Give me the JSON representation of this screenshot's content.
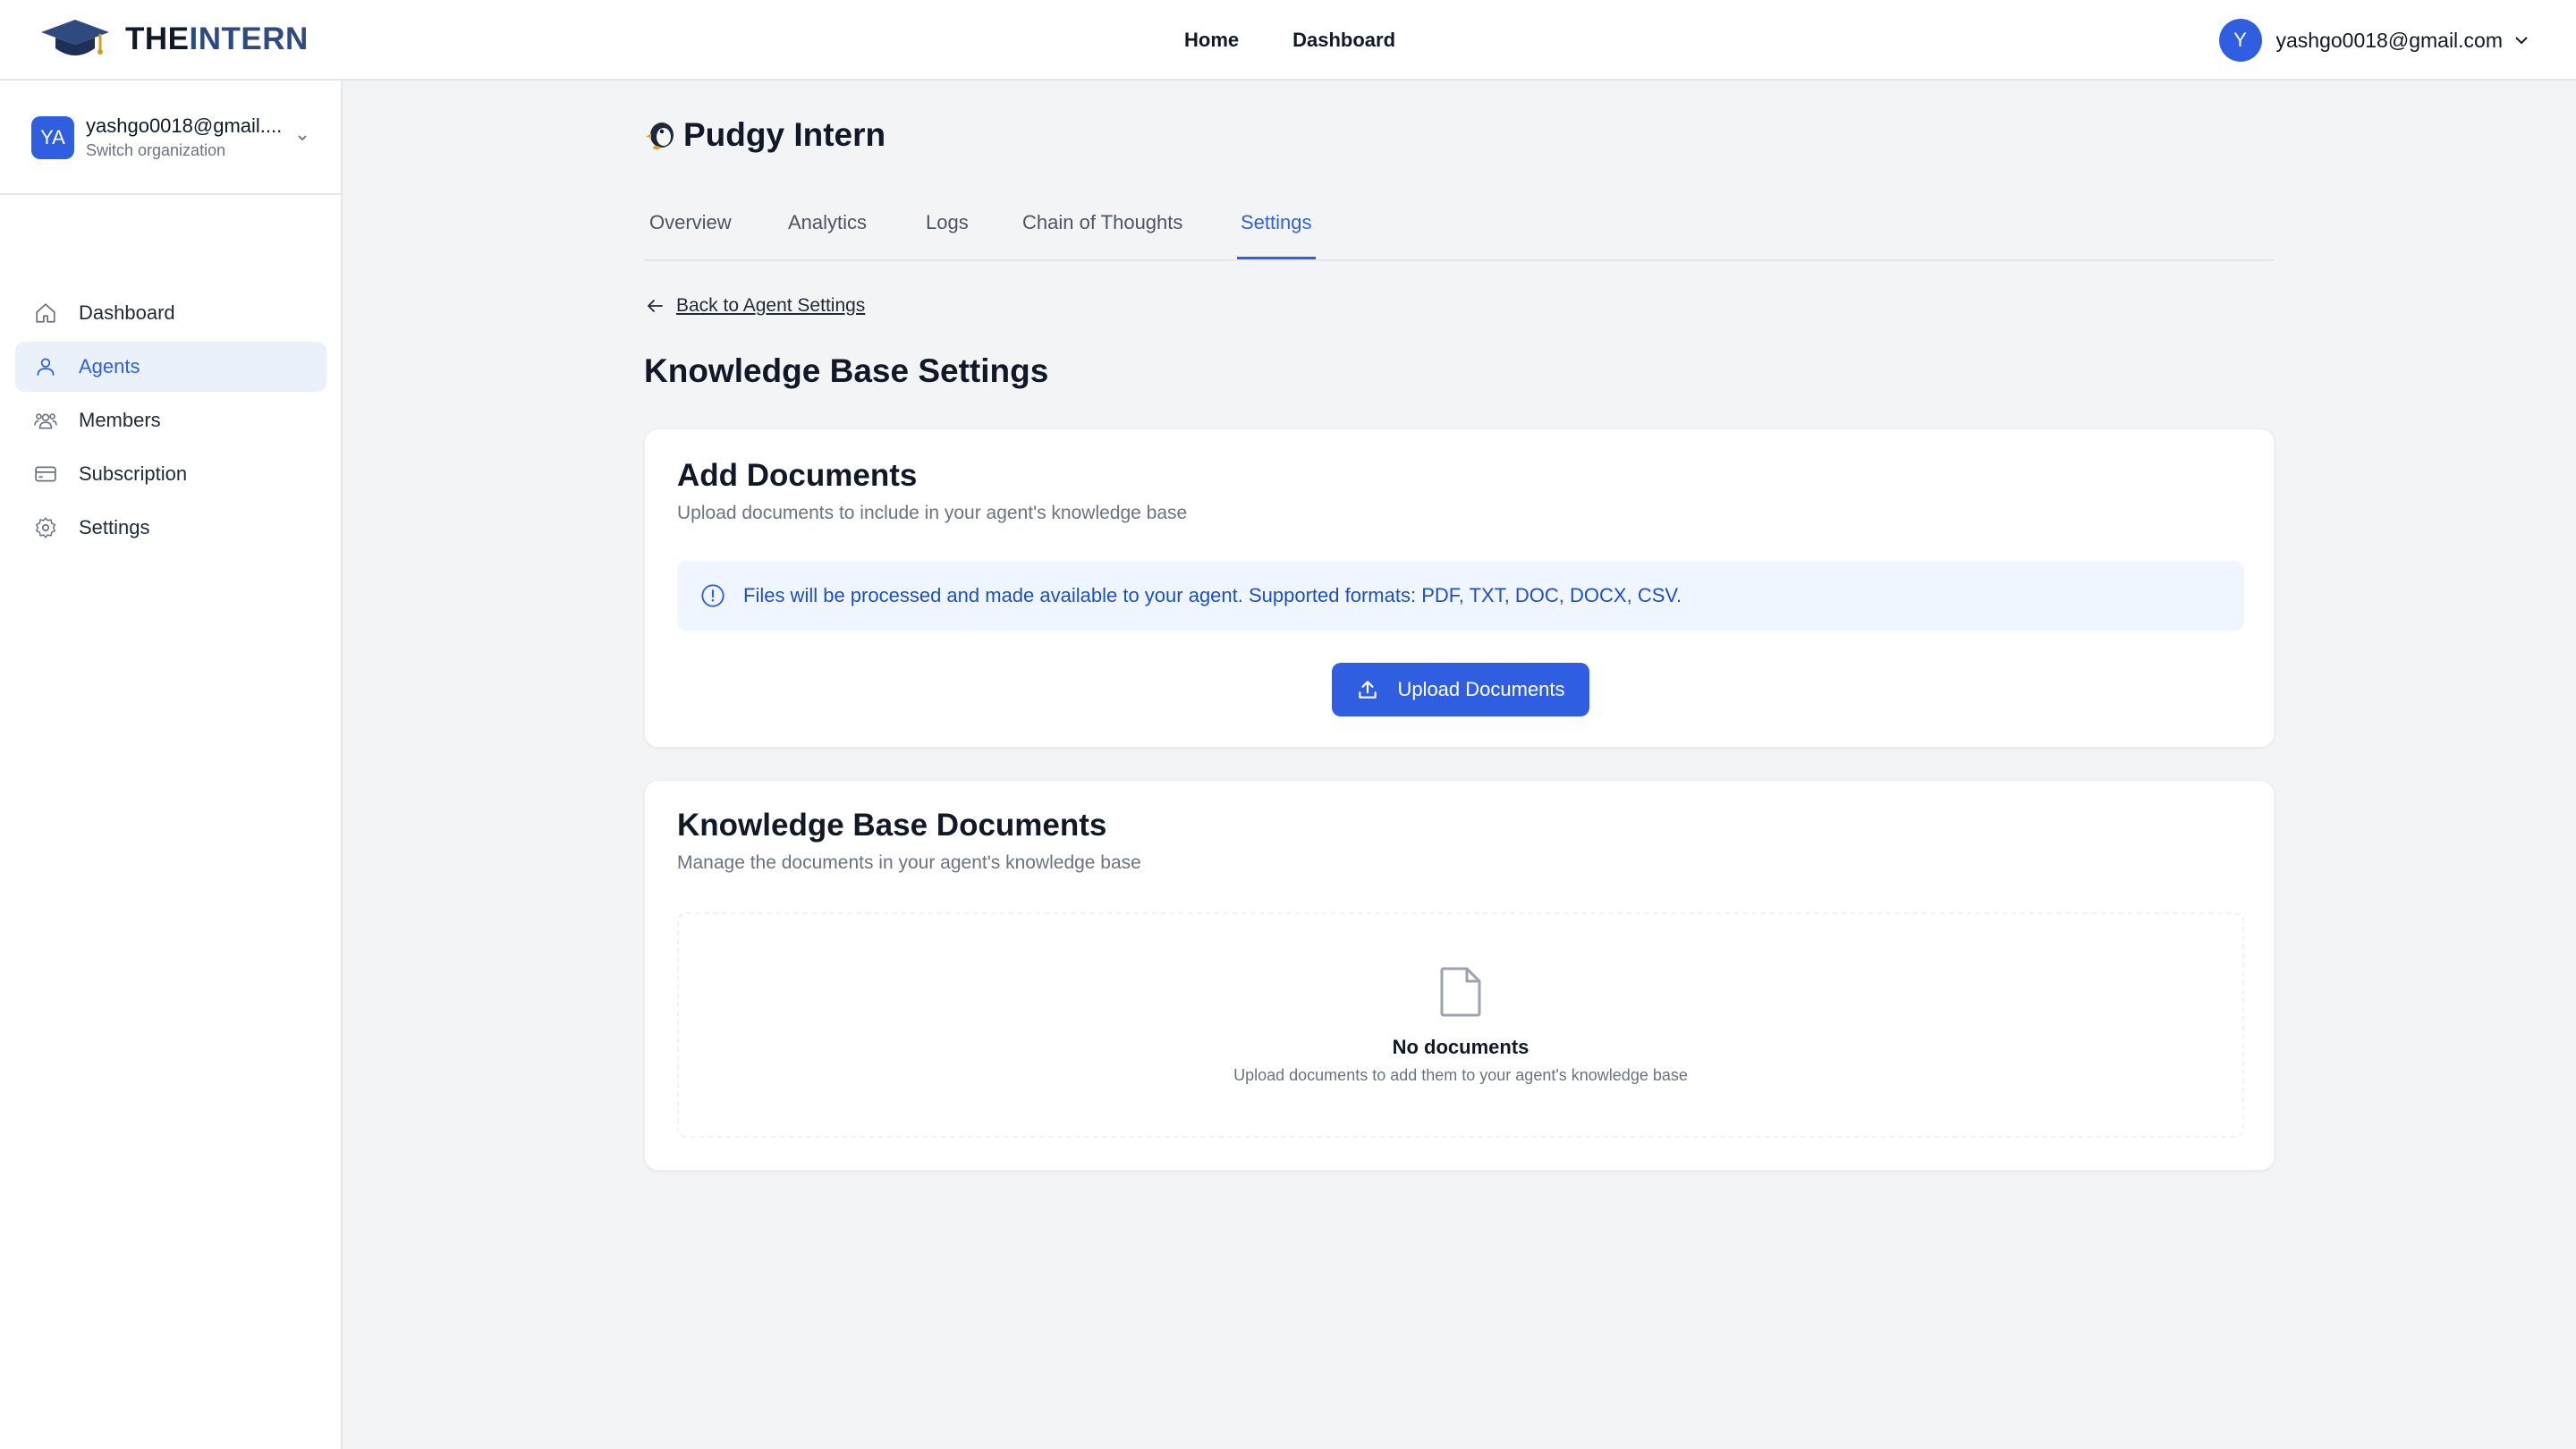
{
  "brand": {
    "logo_the": "THE",
    "logo_intern": "INTERN",
    "logo_icon": "graduation-cap-icon"
  },
  "topnav": {
    "home": "Home",
    "dashboard": "Dashboard"
  },
  "user": {
    "avatar_initial": "Y",
    "email": "yashgo0018@gmail.com"
  },
  "org": {
    "avatar": "YA",
    "name": "yashgo0018@gmail....",
    "subtitle": "Switch organization"
  },
  "sidebar": {
    "items": [
      {
        "label": "Dashboard",
        "icon": "home-icon",
        "active": false
      },
      {
        "label": "Agents",
        "icon": "user-icon",
        "active": true
      },
      {
        "label": "Members",
        "icon": "users-icon",
        "active": false
      },
      {
        "label": "Subscription",
        "icon": "credit-card-icon",
        "active": false
      },
      {
        "label": "Settings",
        "icon": "gear-icon",
        "active": false
      }
    ]
  },
  "agent": {
    "name": "Pudgy Intern",
    "icon": "penguin-icon"
  },
  "tabs": [
    {
      "label": "Overview",
      "active": false
    },
    {
      "label": "Analytics",
      "active": false
    },
    {
      "label": "Logs",
      "active": false
    },
    {
      "label": "Chain of Thoughts",
      "active": false
    },
    {
      "label": "Settings",
      "active": true
    }
  ],
  "back_link": "Back to Agent Settings",
  "page_title": "Knowledge Base Settings",
  "add_documents": {
    "title": "Add Documents",
    "description": "Upload documents to include in your agent's knowledge base",
    "info": "Files will be processed and made available to your agent. Supported formats: PDF, TXT, DOC, DOCX, CSV.",
    "upload_label": "Upload Documents"
  },
  "kb_documents": {
    "title": "Knowledge Base Documents",
    "description": "Manage the documents in your agent's knowledge base",
    "empty_title": "No documents",
    "empty_description": "Upload documents to add them to your agent's knowledge base"
  },
  "colors": {
    "accent": "#2f5fe0",
    "accent_bg": "#eaf1fb",
    "info_bg": "#eff6ff",
    "info_text": "#1e4fc2",
    "page_bg": "#f3f4f6"
  }
}
